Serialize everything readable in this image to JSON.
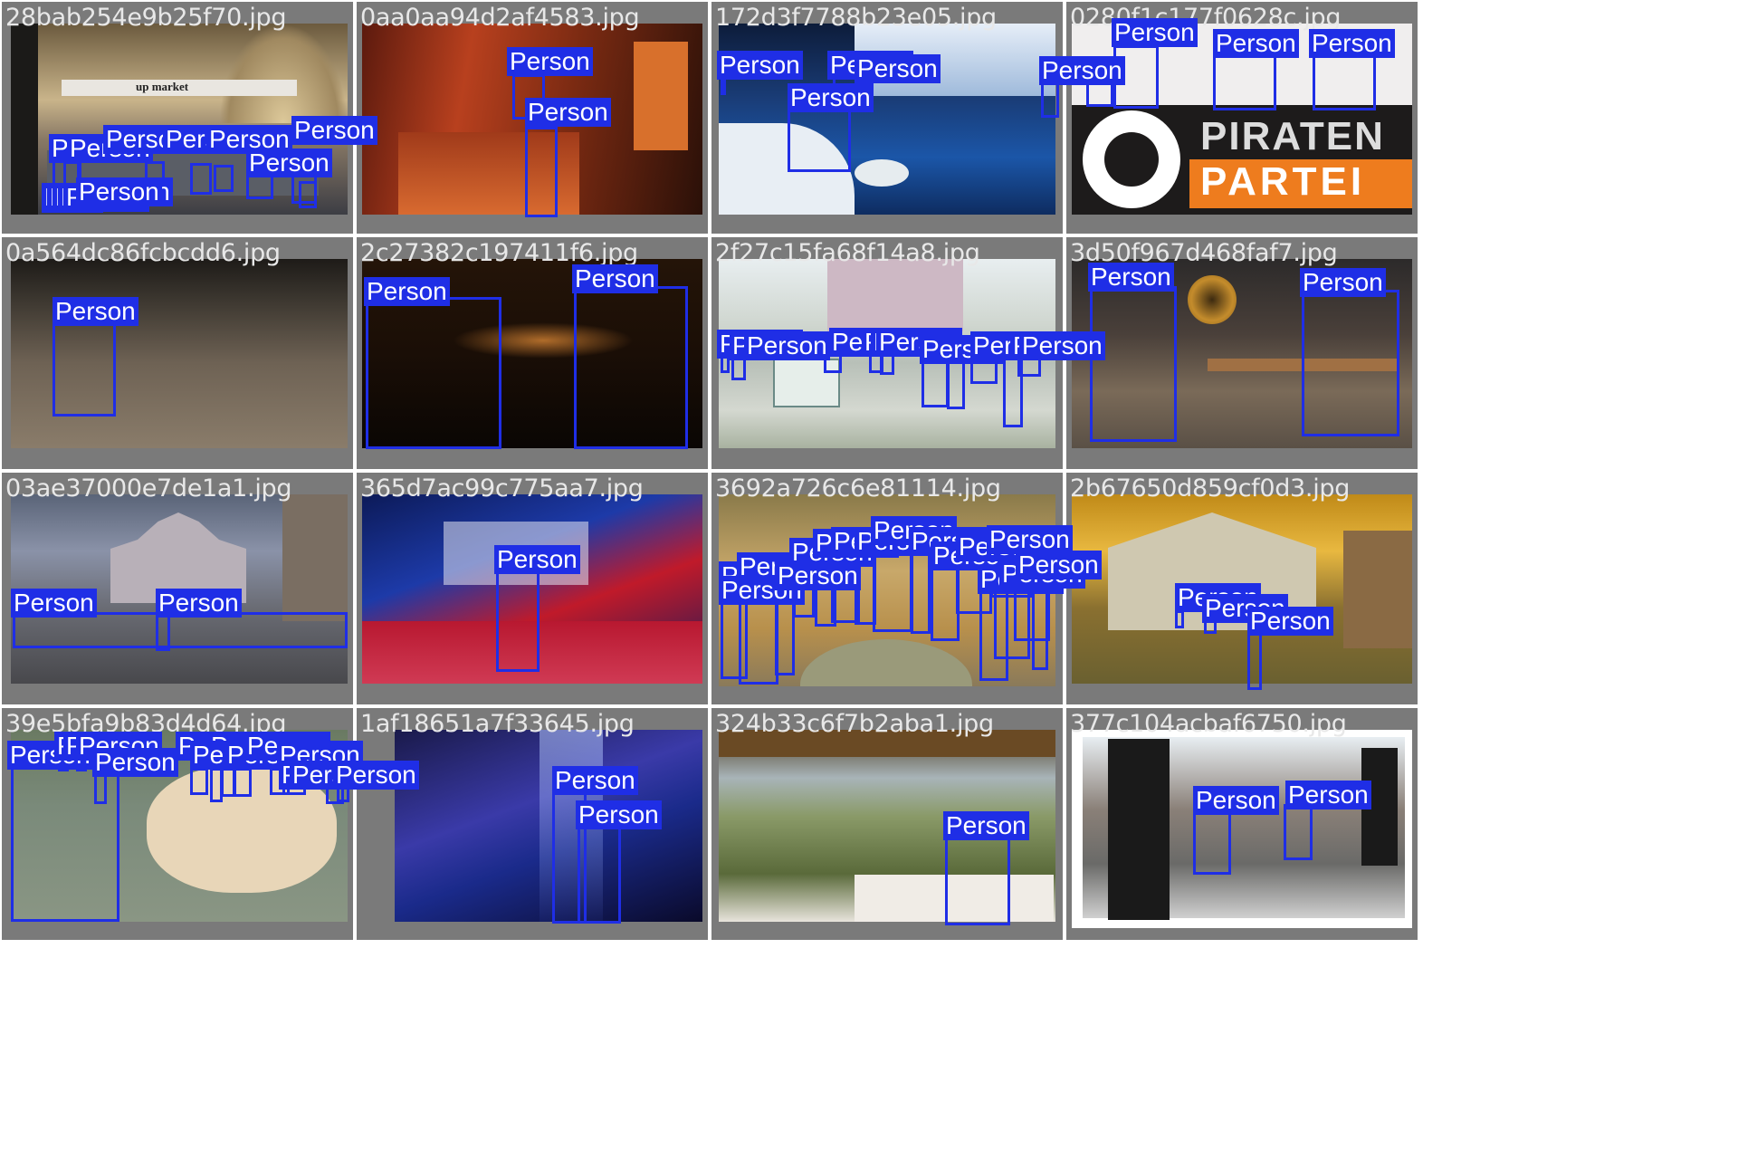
{
  "class_label": "Person",
  "box_color": "#1f2ee6",
  "images": [
    {
      "filename": "28bab254e9b25f70.jpg",
      "scene": "supermarket interior",
      "sign_text": "up market",
      "persons": 12
    },
    {
      "filename": "0aa0aa94d2af4583.jpg",
      "scene": "red museum corridor",
      "persons": 2
    },
    {
      "filename": "172d3f7788b23e05.jpg",
      "scene": "beluga aquarium",
      "persons": 4
    },
    {
      "filename": "0280f1c177f0628c.jpg",
      "scene": "press conference",
      "sign_text_1": "PIRATEN",
      "sign_text_2": "PARTEI",
      "persons": 4
    },
    {
      "filename": "0a564dc86fcbcdd6.jpg",
      "scene": "bmx ramp",
      "persons": 1
    },
    {
      "filename": "2c27382c197411f6.jpg",
      "scene": "dark candle-lit room",
      "persons": 2
    },
    {
      "filename": "2f27c15fa68f14a8.jpg",
      "scene": "street market",
      "persons": 10
    },
    {
      "filename": "3d50f967d468faf7.jpg",
      "scene": "music performance",
      "persons": 2
    },
    {
      "filename": "03ae37000e7de1a1.jpg",
      "scene": "cathedral square at dusk",
      "persons": 2
    },
    {
      "filename": "365d7ac99c775aa7.jpg",
      "scene": "stage with led screen",
      "persons": 1
    },
    {
      "filename": "3692a726c6e81114.jpg",
      "scene": "renaissance fresco",
      "persons": 16
    },
    {
      "filename": "2b67650d859cf0d3.jpg",
      "scene": "3d rendered temple",
      "persons": 3
    },
    {
      "filename": "39e5bfa9b83d4d64.jpg",
      "scene": "cattle show",
      "persons": 12
    },
    {
      "filename": "1af18651a7f33645.jpg",
      "scene": "concert stage",
      "persons": 2
    },
    {
      "filename": "324b33c6f7b2aba1.jpg",
      "scene": "savanna restaurant",
      "persons": 1
    },
    {
      "filename": "377c104acbaf6750.jpg",
      "scene": "outdoor stage",
      "persons": 2
    }
  ]
}
